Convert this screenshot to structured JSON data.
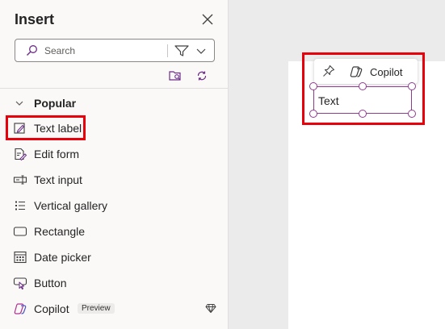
{
  "pane": {
    "title": "Insert",
    "search": {
      "placeholder": "Search",
      "value": ""
    }
  },
  "popular": {
    "label": "Popular",
    "items": [
      {
        "label": "Text label",
        "icon": "text-label-icon"
      },
      {
        "label": "Edit form",
        "icon": "edit-form-icon"
      },
      {
        "label": "Text input",
        "icon": "text-input-icon"
      },
      {
        "label": "Vertical gallery",
        "icon": "vertical-gallery-icon"
      },
      {
        "label": "Rectangle",
        "icon": "rectangle-icon"
      },
      {
        "label": "Date picker",
        "icon": "date-picker-icon"
      },
      {
        "label": "Button",
        "icon": "button-icon"
      },
      {
        "label": "Copilot",
        "icon": "copilot-icon",
        "badge": "Preview"
      }
    ]
  },
  "canvas": {
    "toolbar": {
      "copilot_label": "Copilot"
    },
    "control_text": "Text"
  },
  "colors": {
    "highlight": "#e8000b",
    "selection": "#8e3c8e",
    "pane_bg": "#faf9f8",
    "canvas_bg": "#ebebeb"
  }
}
